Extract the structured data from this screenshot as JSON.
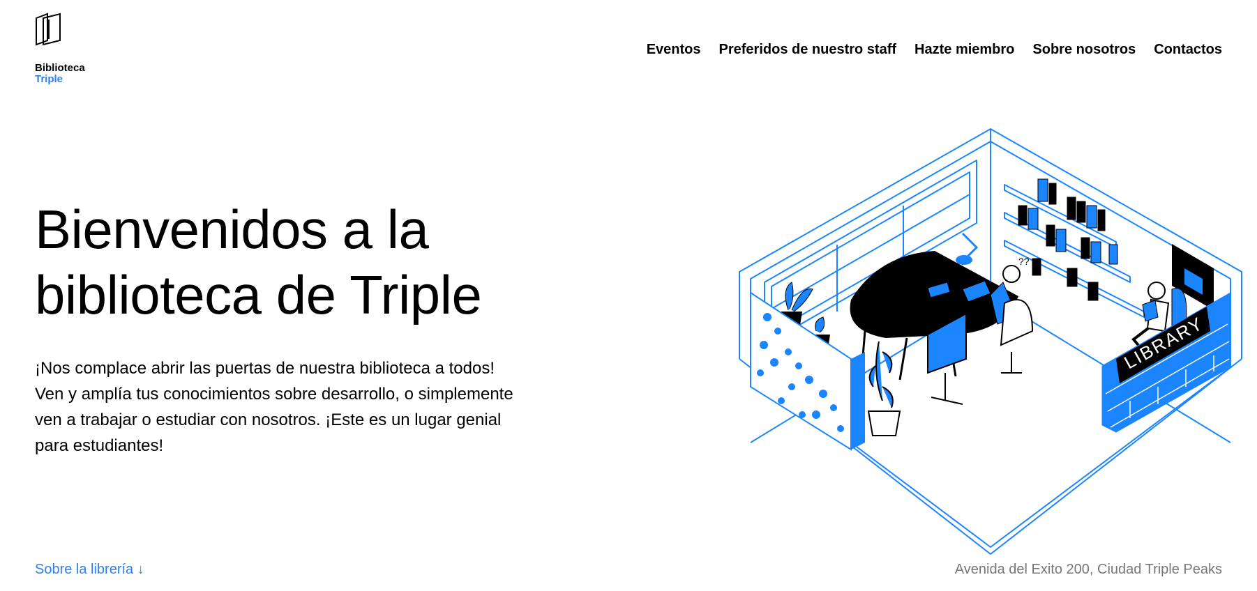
{
  "logo": {
    "line1": "Biblioteca",
    "line2": "Triple"
  },
  "nav": {
    "items": [
      "Eventos",
      "Preferidos de nuestro staff",
      "Hazte miembro",
      "Sobre nosotros",
      "Contactos"
    ]
  },
  "hero": {
    "title": "Bienvenidos a la biblioteca de Triple",
    "body": "¡Nos complace abrir las puertas de nuestra biblioteca a todos! Ven y amplía tus conocimientos sobre desarrollo, o simplemente ven a trabajar o estudiar con nosotros. ¡Este es un lugar genial para estudiantes!"
  },
  "footer": {
    "link": "Sobre la librería ↓",
    "address": "Avenida del Exito 200, Ciudad Triple Peaks"
  },
  "illustration": {
    "sign_text": "LIBRARY"
  },
  "colors": {
    "accent": "#2f80ed",
    "illustration_blue": "#1a85ff",
    "muted": "#777777"
  }
}
